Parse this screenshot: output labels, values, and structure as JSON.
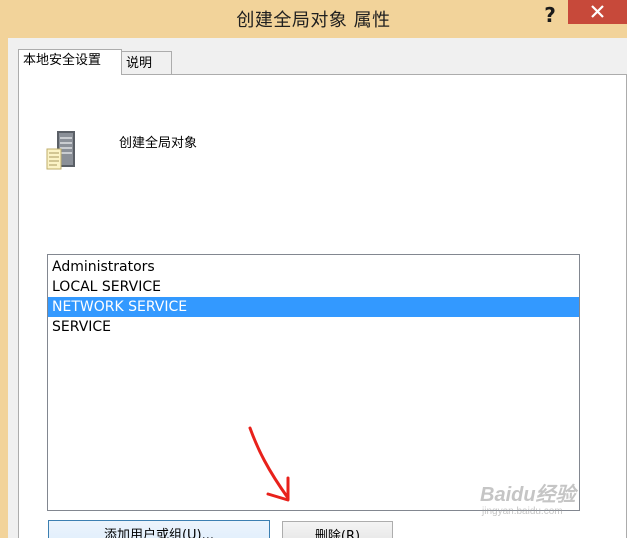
{
  "window": {
    "title": "创建全局对象 属性",
    "help_label": "?",
    "close_icon": "close-icon",
    "accent_color": "#f2d39a",
    "close_color": "#c7493a"
  },
  "tabs": [
    {
      "label": "本地安全设置",
      "active": true
    },
    {
      "label": "说明",
      "active": false
    }
  ],
  "policy": {
    "icon": "server-icon",
    "name": "创建全局对象"
  },
  "accounts": {
    "items": [
      {
        "label": "Administrators",
        "selected": false
      },
      {
        "label": "LOCAL SERVICE",
        "selected": false
      },
      {
        "label": "NETWORK SERVICE",
        "selected": true
      },
      {
        "label": "SERVICE",
        "selected": false
      }
    ],
    "selection_color": "#3399ff"
  },
  "buttons": {
    "add_label": "添加用户或组(U)...",
    "remove_label": "删除(R)"
  },
  "annotation": {
    "type": "red-arrow",
    "color": "#e8211b"
  },
  "watermark": {
    "logo": "Baidu经验",
    "url": "jingyan.baidu.com"
  }
}
